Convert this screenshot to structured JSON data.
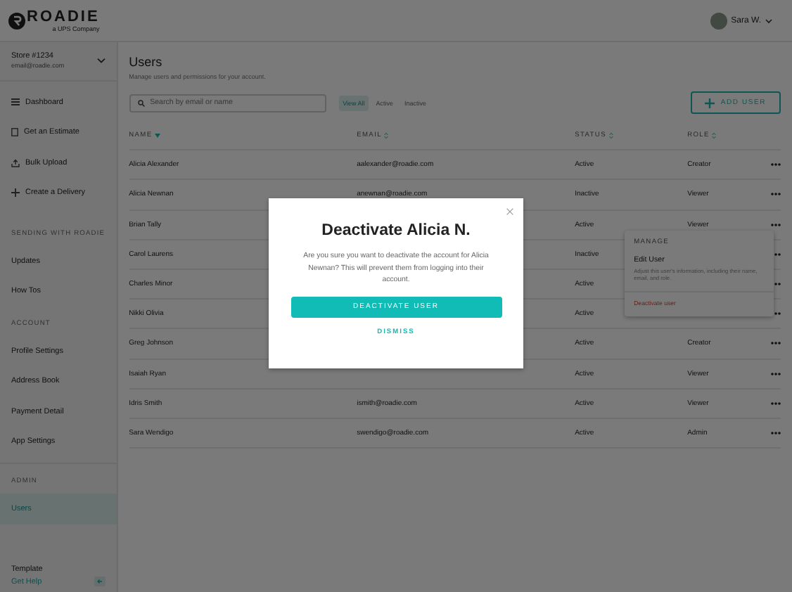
{
  "header": {
    "logo": "ROADIE",
    "logo_tagline": "a UPS Company",
    "user": "Sara W."
  },
  "sidebar": {
    "store": {
      "name": "Store #1234",
      "email": "email@roadie.com"
    },
    "nav": [
      {
        "label": "Dashboard"
      },
      {
        "label": "Get an Estimate"
      },
      {
        "label": "Bulk Upload"
      },
      {
        "label": "Create a Delivery"
      }
    ],
    "sections": [
      {
        "heading": "SENDING WITH ROADIE",
        "items": [
          {
            "label": "Updates",
            "selected": false
          },
          {
            "label": "How Tos",
            "selected": false
          }
        ]
      },
      {
        "heading": "ACCOUNT",
        "items": [
          {
            "label": "Profile Settings",
            "selected": false
          },
          {
            "label": "Address Book",
            "selected": false
          },
          {
            "label": "Payment Detail",
            "selected": false
          },
          {
            "label": "App Settings",
            "selected": false
          }
        ]
      },
      {
        "heading": "ADMIN",
        "items": [
          {
            "label": "Users",
            "selected": true
          }
        ]
      }
    ],
    "template": "Template",
    "help_link": "Get Help"
  },
  "page": {
    "title": "Users",
    "subtitle": "Manage users and permissions for your account.",
    "search": {
      "placeholder": "Search by email or name"
    },
    "filters": [
      {
        "label": "View All",
        "selected": true
      },
      {
        "label": "Active",
        "selected": false
      },
      {
        "label": "Inactive",
        "selected": false
      }
    ],
    "add_button": "ADD USER"
  },
  "table": {
    "columns": [
      {
        "label": "NAME"
      },
      {
        "label": "EMAIL"
      },
      {
        "label": "STATUS"
      },
      {
        "label": "ROLE"
      }
    ],
    "rows": [
      {
        "name": "Alicia Alexander",
        "email": "aalexander@roadie.com",
        "status": "Active",
        "role": "Creator"
      },
      {
        "name": "Alicia Newnan",
        "email": "anewnan@roadie.com",
        "status": "Inactive",
        "role": "Viewer"
      },
      {
        "name": "Brian Tally",
        "status": "Active",
        "role": "Viewer"
      },
      {
        "name": "Carol Laurens",
        "status": "Inactive"
      },
      {
        "name": "Charles Minor",
        "status": "Active"
      },
      {
        "name": "Nikki Olivia",
        "status": "Active"
      },
      {
        "name": "Greg Johnson",
        "status": "Active",
        "role": "Creator"
      },
      {
        "name": "Isaiah Ryan",
        "status": "Active",
        "role": "Viewer"
      },
      {
        "name": "Idris Smith",
        "email": "ismith@roadie.com",
        "status": "Active",
        "role": "Viewer"
      },
      {
        "name": "Sara Wendigo",
        "email": "swendigo@roadie.com",
        "status": "Active",
        "role": "Admin"
      }
    ]
  },
  "row_menu": {
    "heading": "MANAGE",
    "items": [
      {
        "kind": "option",
        "label": "Edit User",
        "description": "Adjust this user's information, including their name, email, and role."
      },
      {
        "kind": "danger",
        "label": "Deactivate user"
      }
    ]
  },
  "modal": {
    "title": "Deactivate Alicia N.",
    "message": "Are you sure you want to deactivate the account for Alicia Newnan? This will prevent them from logging into their account.",
    "confirm": "DEACTIVATE USER",
    "dismiss": "DISMISS"
  }
}
